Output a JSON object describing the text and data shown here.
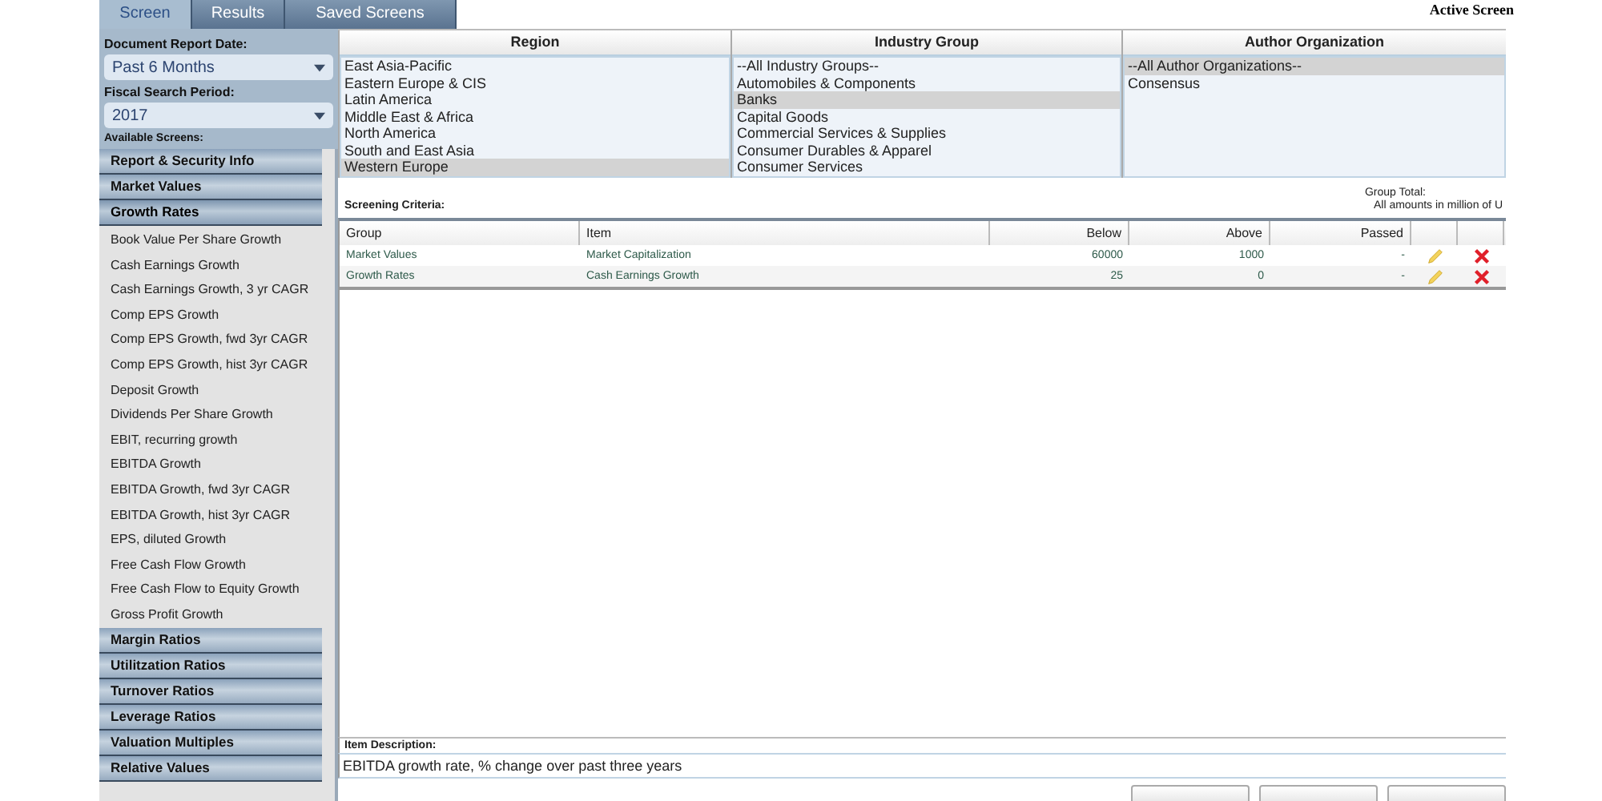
{
  "tabs": [
    {
      "label": "Screen",
      "selected": true
    },
    {
      "label": "Results",
      "selected": false
    },
    {
      "label": "Saved Screens",
      "selected": false
    }
  ],
  "active_screen_label": "Active Screen",
  "sidebar": {
    "report_date": {
      "label": "Document Report Date:",
      "value": "Past 6 Months"
    },
    "fiscal_period": {
      "label": "Fiscal Search Period:",
      "value": "2017"
    },
    "available_label": "Available Screens:",
    "categories": [
      {
        "label": "Report & Security Info",
        "expanded": false
      },
      {
        "label": "Market Values",
        "expanded": false
      },
      {
        "label": "Growth Rates",
        "expanded": true,
        "children": [
          "Book Value Per Share Growth",
          "Cash Earnings Growth",
          "Cash Earnings Growth, 3 yr CAGR",
          "Comp EPS Growth",
          "Comp EPS Growth, fwd 3yr CAGR",
          "Comp EPS Growth, hist 3yr CAGR",
          "Deposit Growth",
          "Dividends Per Share Growth",
          "EBIT, recurring growth",
          "EBITDA Growth",
          "EBITDA Growth, fwd 3yr CAGR",
          "EBITDA Growth, hist 3yr CAGR",
          "EPS, diluted Growth",
          "Free Cash Flow Growth",
          "Free Cash Flow to Equity Growth",
          "Gross Profit Growth"
        ]
      },
      {
        "label": "Margin Ratios",
        "expanded": false
      },
      {
        "label": "Utilitzation Ratios",
        "expanded": false
      },
      {
        "label": "Turnover Ratios",
        "expanded": false
      },
      {
        "label": "Leverage Ratios",
        "expanded": false
      },
      {
        "label": "Valuation Multiples",
        "expanded": false
      },
      {
        "label": "Relative Values",
        "expanded": false
      }
    ]
  },
  "filters": [
    {
      "title": "Region",
      "options": [
        {
          "label": "East Asia-Pacific",
          "selected": false
        },
        {
          "label": "Eastern Europe & CIS",
          "selected": false
        },
        {
          "label": "Latin America",
          "selected": false
        },
        {
          "label": "Middle East & Africa",
          "selected": false
        },
        {
          "label": "North America",
          "selected": false
        },
        {
          "label": "South and East Asia",
          "selected": false
        },
        {
          "label": "Western Europe",
          "selected": true
        }
      ]
    },
    {
      "title": "Industry Group",
      "options": [
        {
          "label": "--All Industry Groups--",
          "selected": false
        },
        {
          "label": "Automobiles & Components",
          "selected": false
        },
        {
          "label": "Banks",
          "selected": true
        },
        {
          "label": "Capital Goods",
          "selected": false
        },
        {
          "label": "Commercial Services & Supplies",
          "selected": false
        },
        {
          "label": "Consumer Durables & Apparel",
          "selected": false
        },
        {
          "label": "Consumer Services",
          "selected": false
        }
      ]
    },
    {
      "title": "Author Organization",
      "options": [
        {
          "label": "--All Author Organizations--",
          "selected": true
        },
        {
          "label": "Consensus",
          "selected": false
        }
      ]
    }
  ],
  "criteria": {
    "label": "Screening Criteria:",
    "group_total": "Group Total:",
    "amounts_note": "All amounts in million of U",
    "columns": [
      "Group",
      "Item",
      "Below",
      "Above",
      "Passed"
    ],
    "rows": [
      {
        "group": "Market Values",
        "item": "Market Capitalization",
        "below": "60000",
        "above": "1000",
        "passed": "-"
      },
      {
        "group": "Growth Rates",
        "item": "Cash Earnings Growth",
        "below": "25",
        "above": "0",
        "passed": "-"
      }
    ]
  },
  "item_description": {
    "label": "Item Description:",
    "text": "EBITDA growth rate, % change over past three years"
  }
}
